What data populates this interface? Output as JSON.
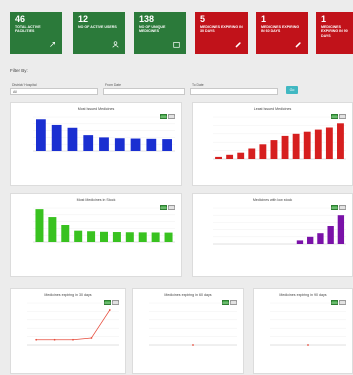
{
  "kpis": [
    {
      "value": "46",
      "label": "TOTAL ACTIVE FACILITIES",
      "color": "green",
      "icon": "pin-icon"
    },
    {
      "value": "12",
      "label": "NO OF ACTIVE USERS",
      "color": "green",
      "icon": "user-icon"
    },
    {
      "value": "138",
      "label": "NO OF UNIQUE MEDICINES",
      "color": "green",
      "icon": "box-icon"
    },
    {
      "value": "5",
      "label": "MEDICINES EXPIRING IN 30 DAYS",
      "color": "red",
      "icon": "pill-icon"
    },
    {
      "value": "1",
      "label": "MEDICINES EXPIRING IN 60 DAYS",
      "color": "red",
      "icon": "pill-icon"
    },
    {
      "value": "1",
      "label": "MEDICINES EXPIRING IN 90 DAYS",
      "color": "red",
      "icon": "pill-icon"
    }
  ],
  "filter": {
    "title": "Filter By:",
    "district_label": "District/ Hospital",
    "district_value": "All",
    "from_label": "From Date",
    "to_label": "To Date",
    "ok_label": "Go"
  },
  "cards": {
    "c1": {
      "title": "Most Issued Medicines"
    },
    "c2": {
      "title": "Least Issued Medicines"
    },
    "c3": {
      "title": "Most Medicines in Stock"
    },
    "c4": {
      "title": "Medicines with low stock"
    },
    "c5": {
      "title": "Medicines expiring in 30 days"
    },
    "c6": {
      "title": "Medicines expiring in 60 days"
    },
    "c7": {
      "title": "Medicines expiring in 90 days"
    }
  },
  "chart_data": [
    {
      "type": "bar",
      "color": "#1a2fd1",
      "categories": [
        "",
        "",
        "",
        "",
        "",
        "",
        "",
        "",
        ""
      ],
      "values": [
        1120,
        920,
        820,
        560,
        480,
        450,
        440,
        430,
        420
      ],
      "ylim": [
        0,
        1200
      ]
    },
    {
      "type": "bar",
      "color": "#d61f1f",
      "categories": [
        "",
        "",
        "",
        "",
        "",
        "",
        "",
        "",
        "",
        "",
        "",
        ""
      ],
      "values": [
        1,
        2,
        3,
        5,
        7,
        9,
        11,
        12,
        13,
        14,
        15,
        17
      ],
      "ylim": [
        0,
        20
      ]
    },
    {
      "type": "bar",
      "color": "#39c220",
      "categories": [
        "",
        "",
        "",
        "",
        "",
        "",
        "",
        "",
        "",
        "",
        ""
      ],
      "values": [
        2900,
        2200,
        1500,
        1000,
        950,
        900,
        880,
        860,
        850,
        840,
        830
      ],
      "ylim": [
        0,
        3000
      ]
    },
    {
      "type": "bar",
      "color": "#7a12a8",
      "categories": [
        "",
        "",
        "",
        "",
        "",
        "",
        "",
        "",
        "",
        "",
        "",
        "",
        ""
      ],
      "values": [
        0,
        0,
        0,
        0,
        0,
        0,
        0,
        0,
        1,
        2,
        3,
        5,
        8
      ],
      "ylim": [
        0,
        10
      ]
    },
    {
      "type": "line",
      "color": "#e74c3c",
      "categories": [
        "",
        "",
        "",
        "",
        ""
      ],
      "values": [
        150,
        150,
        150,
        200,
        1000
      ],
      "ylim": [
        0,
        1200
      ]
    },
    {
      "type": "line",
      "color": "#e74c3c",
      "categories": [
        ""
      ],
      "values": [
        0
      ],
      "ylim": [
        0,
        10
      ]
    },
    {
      "type": "line",
      "color": "#e74c3c",
      "categories": [
        ""
      ],
      "values": [
        0
      ],
      "ylim": [
        0,
        10
      ]
    }
  ]
}
